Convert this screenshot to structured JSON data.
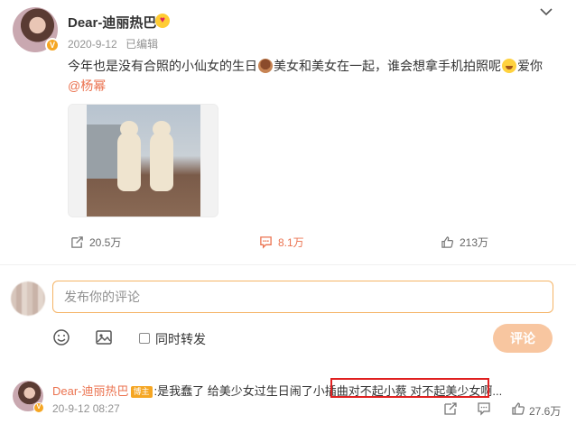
{
  "post": {
    "author": "Dear-迪丽热巴",
    "date": "2020-9-12",
    "edited": "已编辑",
    "text_part1": "今年也是没有合照的小仙女的生日",
    "text_part2": "美女和美女在一起，谁会想拿手机拍照呢",
    "text_part3": "爱你",
    "mention": "@杨幂",
    "actions": {
      "repost": "20.5万",
      "comment": "8.1万",
      "like": "213万"
    }
  },
  "composer": {
    "placeholder": "发布你的评论",
    "also_repost_label": "同时转发",
    "submit_label": "评论"
  },
  "comment": {
    "author": "Dear-迪丽热巴",
    "tag": "博主",
    "text_plain": ":是我蠢了 给美少女过生日闹了小插曲",
    "text_highlight": "对不起小蔡 对不起美少女啊...",
    "time": "20-9-12 08:27",
    "likes": "27.6万"
  },
  "colors": {
    "accent": "#eb7350",
    "input_border": "#f5b466",
    "submit_bg": "#f8c6a0",
    "highlight_box": "#e02020"
  }
}
